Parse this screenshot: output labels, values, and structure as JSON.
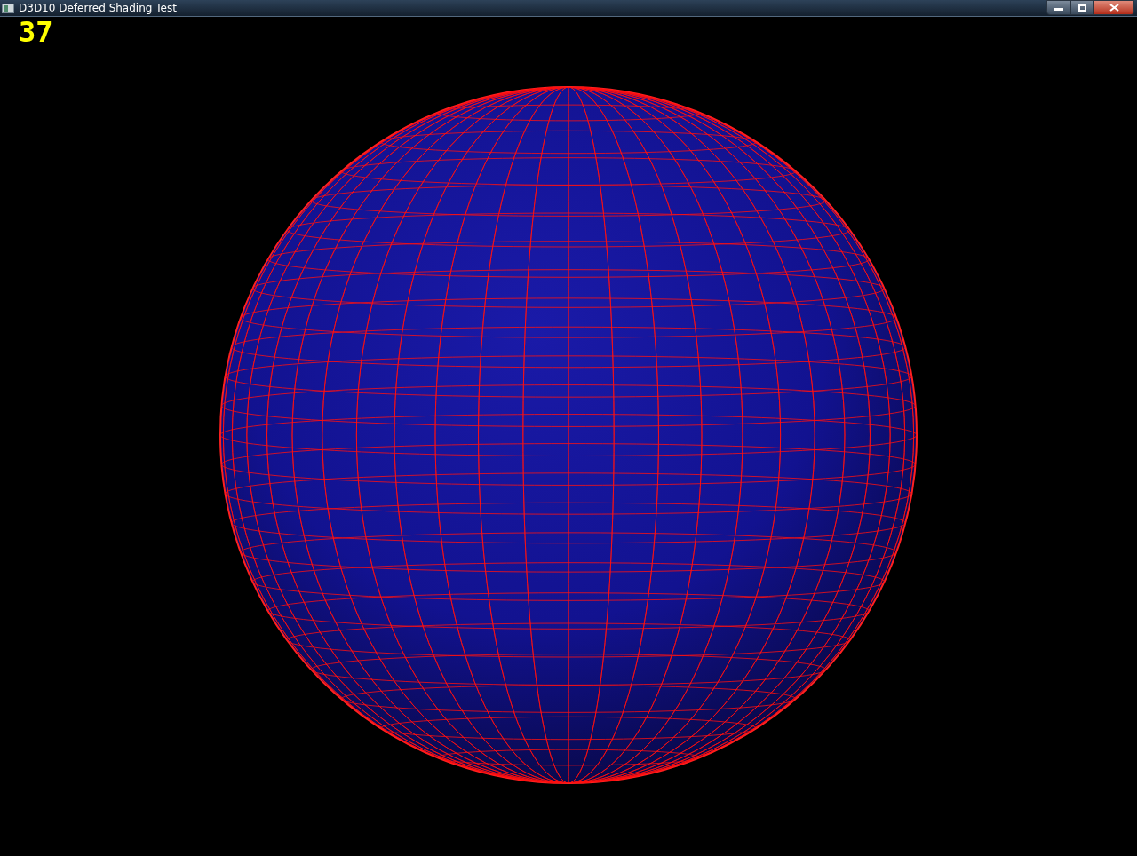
{
  "window": {
    "title": "D3D10 Deferred Shading Test"
  },
  "overlay": {
    "fps": "37"
  }
}
